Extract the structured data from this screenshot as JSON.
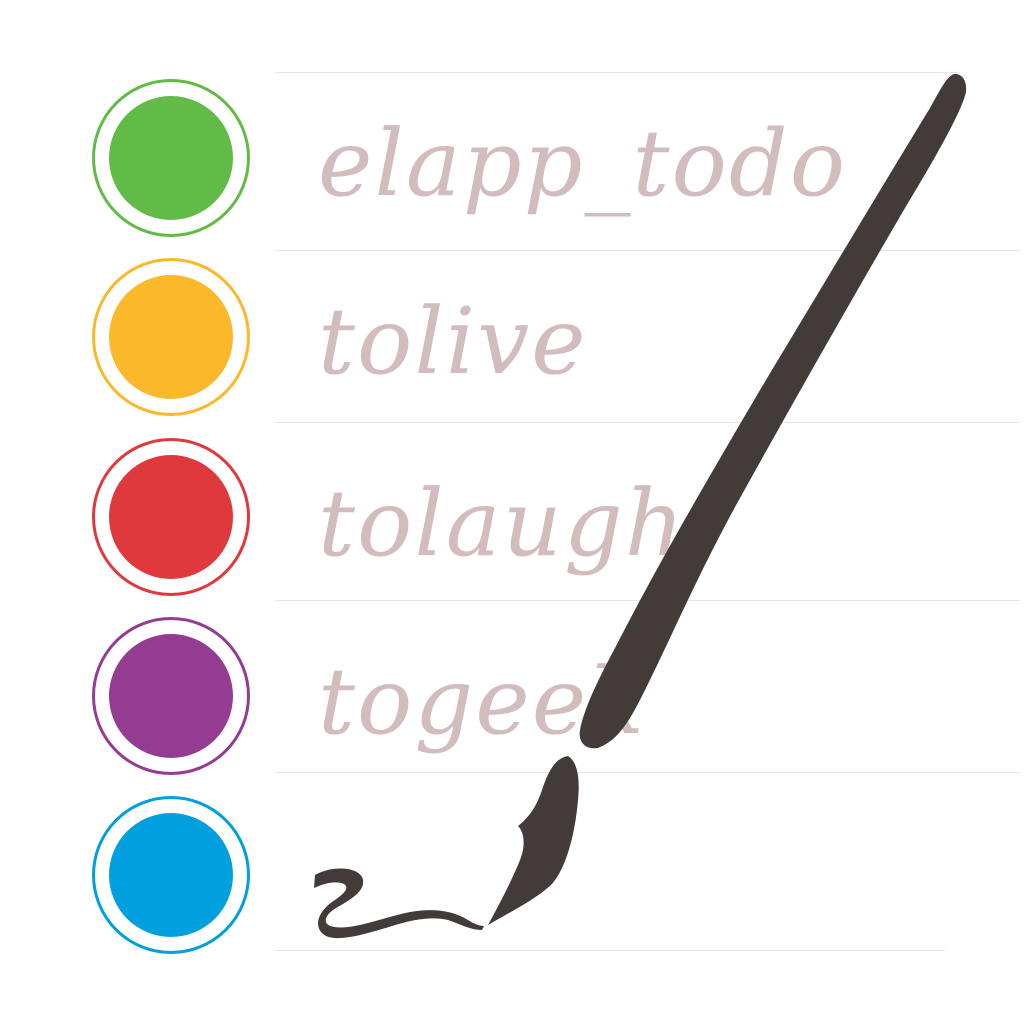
{
  "tasks": [
    {
      "label": "elapp_todo",
      "color": "#63bb47"
    },
    {
      "label": "tolive",
      "color": "#fbb82a"
    },
    {
      "label": "tolaugh",
      "color": "#e0393d"
    },
    {
      "label": "togeek",
      "color": "#943b92"
    },
    {
      "label": "",
      "color": "#009fde"
    }
  ],
  "colors": {
    "script_text": "#d2bcbd",
    "pen": "#433a3a",
    "rule": "#e6e6e6"
  },
  "icons": {
    "pen": "fountain-pen-icon",
    "scribble": "ink-scribble-icon"
  }
}
